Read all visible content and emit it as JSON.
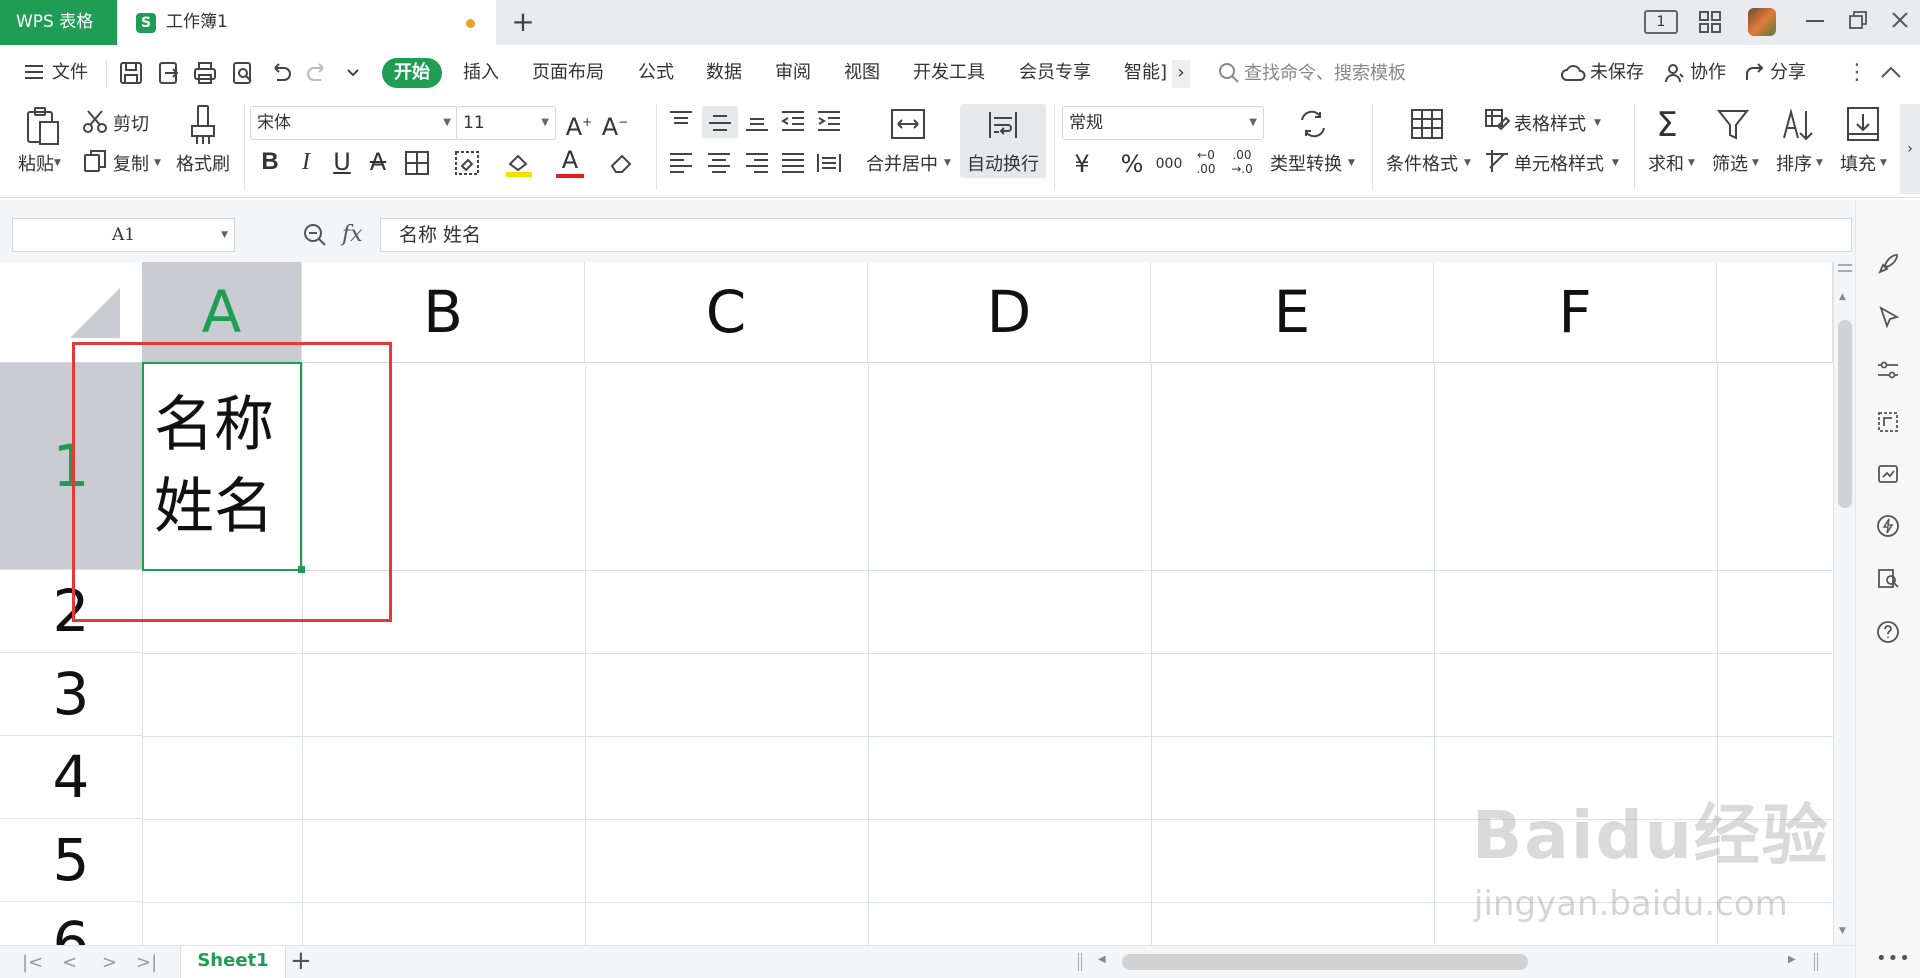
{
  "titlebar": {
    "app_name": "WPS 表格",
    "doc_icon_letter": "S",
    "doc_title": "工作簿1",
    "new_tab": "+",
    "page_badge": "1"
  },
  "menu": {
    "file": "文件",
    "tabs": [
      "开始",
      "插入",
      "页面布局",
      "公式",
      "数据",
      "审阅",
      "视图",
      "开发工具",
      "会员专享",
      "智能]"
    ],
    "more": "›",
    "search_placeholder": "查找命令、搜索模板",
    "unsaved": "未保存",
    "collab": "协作",
    "share": "分享"
  },
  "ribbon": {
    "paste": "粘贴",
    "cut": "剪切",
    "copy": "复制",
    "format_painter": "格式刷",
    "font_name": "宋体",
    "font_size": "11",
    "merge_center": "合并居中",
    "wrap_text": "自动换行",
    "number_format": "常规",
    "type_convert": "类型转换",
    "cond_format": "条件格式",
    "table_style": "表格样式",
    "cell_style": "单元格样式",
    "sum": "求和",
    "filter": "筛选",
    "sort": "排序",
    "fill": "填充"
  },
  "formula_bar": {
    "cell_ref": "A1",
    "fx": "fx",
    "content": "名称  姓名"
  },
  "sheet": {
    "columns": [
      "A",
      "B",
      "C",
      "D",
      "E",
      "F"
    ],
    "rows": [
      "1",
      "2",
      "3",
      "4",
      "5",
      "6"
    ],
    "a1_line1": "名称",
    "a1_line2": "姓名"
  },
  "bottom": {
    "sheet_tab": "Sheet1",
    "add_sheet": "+"
  },
  "watermark": {
    "brand": "Baidu经验",
    "url": "jingyan.baidu.com"
  },
  "colors": {
    "accent": "#1f9d55",
    "highlight_box": "#e53935"
  }
}
